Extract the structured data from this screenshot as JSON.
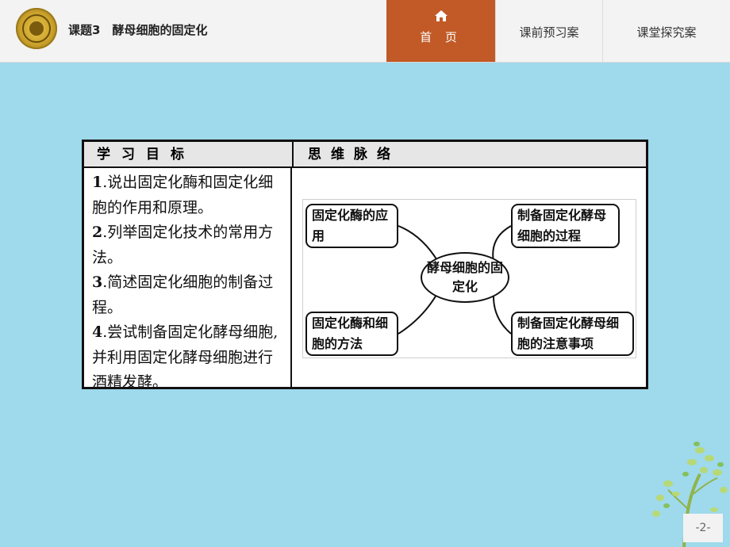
{
  "header": {
    "title": "课题3　酵母细胞的固定化",
    "nav": {
      "home_label": "首 页",
      "tab_preview": "课前预习案",
      "tab_class": "课堂探究案"
    }
  },
  "table": {
    "left_header": "学习目标",
    "right_header": "思维脉络",
    "objectives": [
      {
        "num": "1",
        "text": ".说出固定化酶和固定化细胞的作用和原理。"
      },
      {
        "num": "2",
        "text": ".列举固定化技术的常用方法。"
      },
      {
        "num": "3",
        "text": ".简述固定化细胞的制备过程。"
      },
      {
        "num": "4",
        "text": ".尝试制备固定化酵母细胞,并利用固定化酵母细胞进行酒精发酵。"
      }
    ]
  },
  "mindmap": {
    "center": "酵母细胞的固定化",
    "top_left": "固定化酶的应用",
    "top_right": "制备固定化酵母细胞的过程",
    "bottom_left": "固定化酶和细胞的方法",
    "bottom_right": "制备固定化酵母细胞的注意事项"
  },
  "footer": {
    "page_number": "-2-"
  },
  "colors": {
    "background": "#9fd9ec",
    "home_tab": "#c15a27",
    "topbar": "#f3f3f3"
  },
  "icons": [
    "logo-emblem",
    "home-icon",
    "tree-decoration"
  ]
}
